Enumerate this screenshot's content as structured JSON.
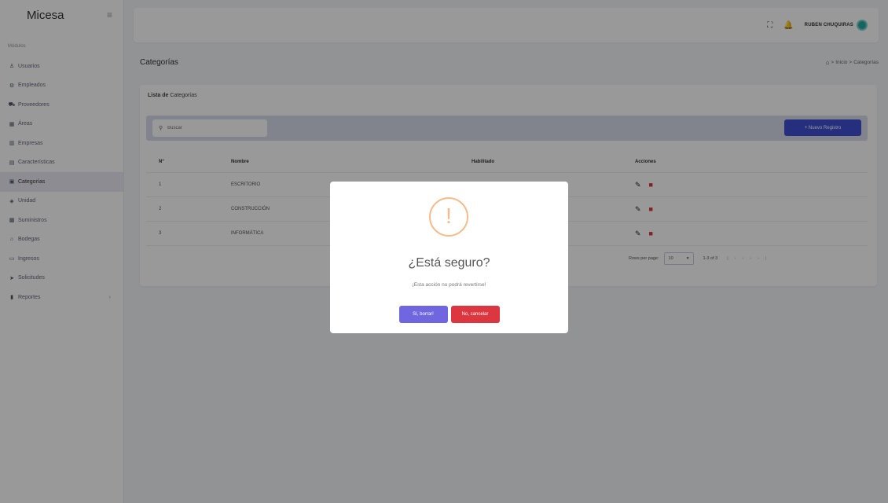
{
  "sidebar": {
    "brand": "Micesa",
    "toggle_icon": "hamburger-icon",
    "section": "Módulos",
    "items": [
      {
        "label": "Usuarios",
        "icon": "user-icon"
      },
      {
        "label": "Empleados",
        "icon": "users-icon"
      },
      {
        "label": "Proveedores",
        "icon": "truck-icon"
      },
      {
        "label": "Áreas",
        "icon": "grid-icon"
      },
      {
        "label": "Empresas",
        "icon": "building-icon"
      },
      {
        "label": "Características",
        "icon": "list-icon"
      },
      {
        "label": "Categorías",
        "icon": "tag-icon",
        "active": true
      },
      {
        "label": "Unidad",
        "icon": "cube-icon"
      },
      {
        "label": "Suministros",
        "icon": "box-icon"
      },
      {
        "label": "Bodegas",
        "icon": "warehouse-icon"
      },
      {
        "label": "Ingresos",
        "icon": "inbox-icon"
      },
      {
        "label": "Solicitudes",
        "icon": "send-icon"
      },
      {
        "label": "Reportes",
        "icon": "chart-icon",
        "has_children": true
      }
    ]
  },
  "topbar": {
    "user": "RUBEN CHUQUIRAS"
  },
  "page": {
    "title": "Categorías",
    "breadcrumb": [
      "Inicio",
      "Categorías"
    ]
  },
  "card": {
    "title_bold": "Lista de",
    "title_rest": "Categorías",
    "search_placeholder": "Buscar",
    "new_button": "+ Nuevo Registro",
    "columns": [
      "N°",
      "Nombre",
      "Habilitado",
      "Acciones"
    ],
    "rows": [
      {
        "num": "1",
        "name": "ESCRITORIO"
      },
      {
        "num": "2",
        "name": "CONSTRUCCIÓN"
      },
      {
        "num": "3",
        "name": "INFORMÁTICA"
      }
    ],
    "pager": {
      "rows_label": "Rows per page:",
      "rows_value": "10",
      "range": "1-3 of 3"
    }
  },
  "modal": {
    "icon": "!",
    "title": "¿Está seguro?",
    "text": "¡Esta acción no podrá revertirse!",
    "confirm": "Sí, borrar!",
    "cancel": "No, cancelar"
  },
  "colors": {
    "primary": "#3e4fd3",
    "confirm": "#7066e0",
    "cancel": "#dc3741",
    "warning": "#f8bb86",
    "delete_icon": "#e03535"
  }
}
